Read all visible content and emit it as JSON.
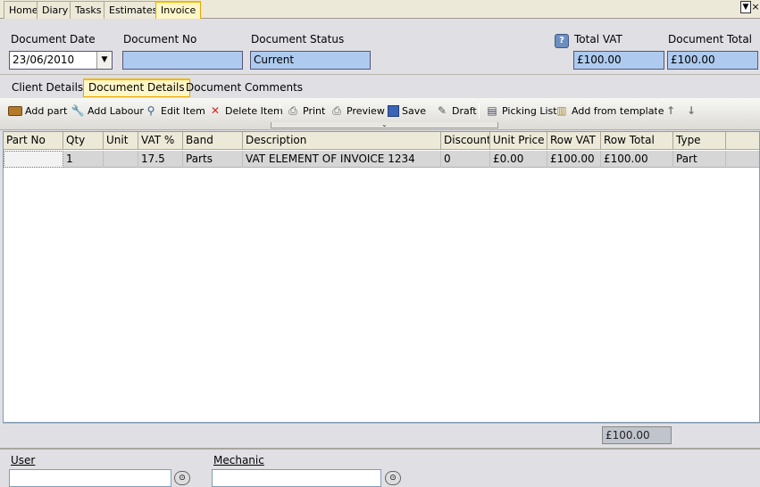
{
  "top_tabs": [
    "Home",
    "Diary",
    "Tasks",
    "Estimates",
    "Invoice"
  ],
  "header": {
    "document_date_label": "Document Date",
    "document_date_value": "23/06/2010",
    "document_no_label": "Document No",
    "document_no_value": "",
    "document_status_label": "Document Status",
    "document_status_value": "Current",
    "total_vat_label": "Total VAT",
    "total_vat_value": "£100.00",
    "document_total_label": "Document Total",
    "document_total_value": "£100.00"
  },
  "sub_tabs": [
    "Client Details",
    "Document Details",
    "Document Comments"
  ],
  "toolbar": {
    "add_part": "Add part",
    "add_labour": "Add Labour",
    "edit_item": "Edit Item",
    "delete_item": "Delete Item",
    "print": "Print",
    "preview": "Preview",
    "save": "Save",
    "draft": "Draft",
    "picking_list": "Picking List",
    "add_from_template": "Add from template"
  },
  "grid": {
    "columns": [
      "Part No",
      "Qty",
      "Unit",
      "VAT %",
      "Band",
      "Description",
      "Discount",
      "Unit Price",
      "Row VAT",
      "Row Total",
      "Type"
    ],
    "rows": [
      [
        "",
        "1",
        "",
        "17.5",
        "Parts",
        "VAT ELEMENT OF INVOICE 1234",
        "0",
        "£0.00",
        "£100.00",
        "£100.00",
        "Part"
      ]
    ]
  },
  "footer": {
    "total": "£100.00"
  },
  "bottom": {
    "user_label": "User",
    "mechanic_label": "Mechanic"
  },
  "colors": {
    "active_tab": "#fff6c8",
    "field_blue": "#aecbef",
    "accent": "#f2b800"
  }
}
